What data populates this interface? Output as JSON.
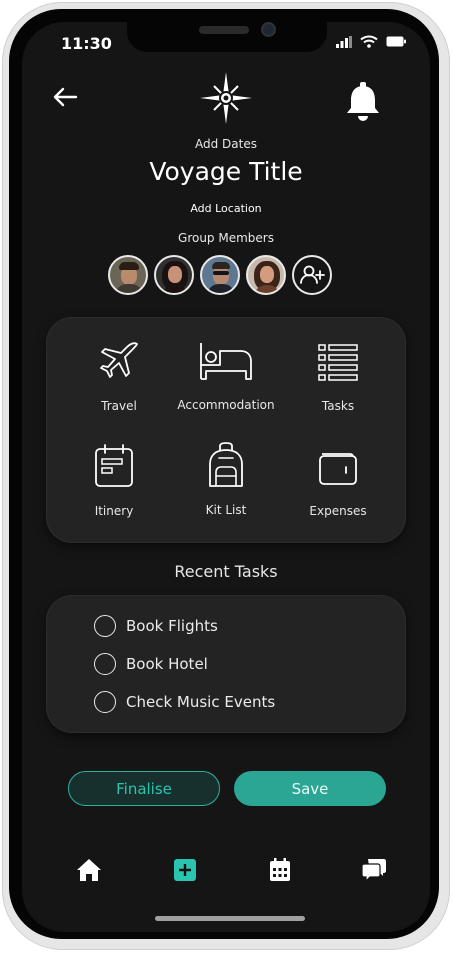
{
  "status_bar": {
    "time": "11:30"
  },
  "header": {
    "back_icon": "arrow-left-icon",
    "logo_icon": "compass-star-icon",
    "notification_icon": "bell-icon",
    "add_dates": "Add Dates",
    "title": "Voyage Title",
    "add_location": "Add Location"
  },
  "group": {
    "label": "Group Members",
    "members": [
      {
        "icon": "avatar-1"
      },
      {
        "icon": "avatar-2"
      },
      {
        "icon": "avatar-3"
      },
      {
        "icon": "avatar-4"
      }
    ],
    "add_member_icon": "add-user-icon"
  },
  "categories": [
    {
      "label": "Travel",
      "icon": "plane-icon"
    },
    {
      "label": "Accommodation",
      "icon": "bed-icon"
    },
    {
      "label": "Tasks",
      "icon": "list-icon"
    },
    {
      "label": "Itinery",
      "icon": "calendar-icon"
    },
    {
      "label": "Kit List",
      "icon": "backpack-icon"
    },
    {
      "label": "Expenses",
      "icon": "wallet-icon"
    }
  ],
  "recent_tasks": {
    "heading": "Recent Tasks",
    "items": [
      {
        "label": "Book Flights",
        "done": false
      },
      {
        "label": "Book Hotel",
        "done": false
      },
      {
        "label": "Check Music Events",
        "done": false
      }
    ]
  },
  "actions": {
    "finalise": "Finalise",
    "save": "Save"
  },
  "bottom_nav": [
    {
      "icon": "home-icon"
    },
    {
      "icon": "add-square-icon",
      "active": true
    },
    {
      "icon": "calendar-grid-icon"
    },
    {
      "icon": "chat-icon"
    }
  ],
  "colors": {
    "accent": "#2ba594",
    "background": "#151515",
    "panel": "#232323"
  }
}
